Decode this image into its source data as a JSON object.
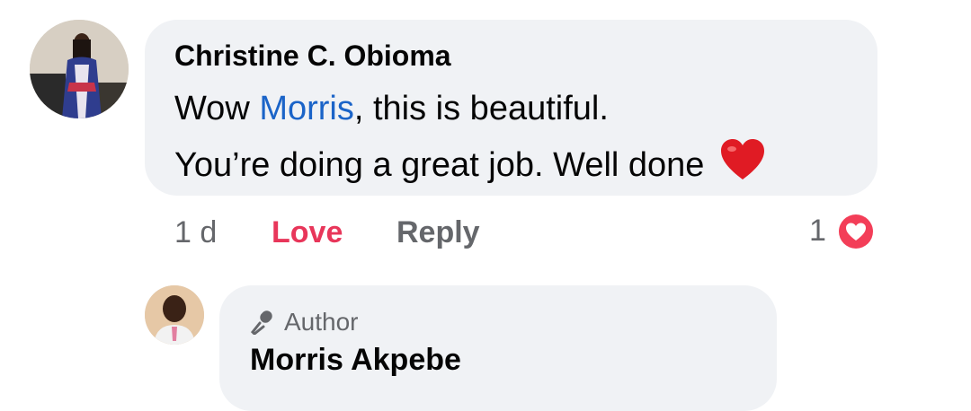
{
  "comment": {
    "author": "Christine C. Obioma",
    "line1_pre": "Wow ",
    "mention": "Morris",
    "line1_post": ", this is beautiful.",
    "line2": "You’re doing a great job. Well done",
    "emoji": "red-heart-icon",
    "time": "1 d",
    "love_label": "Love",
    "reply_label": "Reply",
    "reaction_count": "1",
    "reaction_icon": "love-reaction-icon"
  },
  "reply": {
    "badge": "Author",
    "badge_icon": "microphone-icon",
    "author": "Morris Akpebe"
  },
  "colors": {
    "bubble": "#f0f2f5",
    "love": "#e8365a",
    "mention": "#1b64c8",
    "meta": "#65676b"
  }
}
